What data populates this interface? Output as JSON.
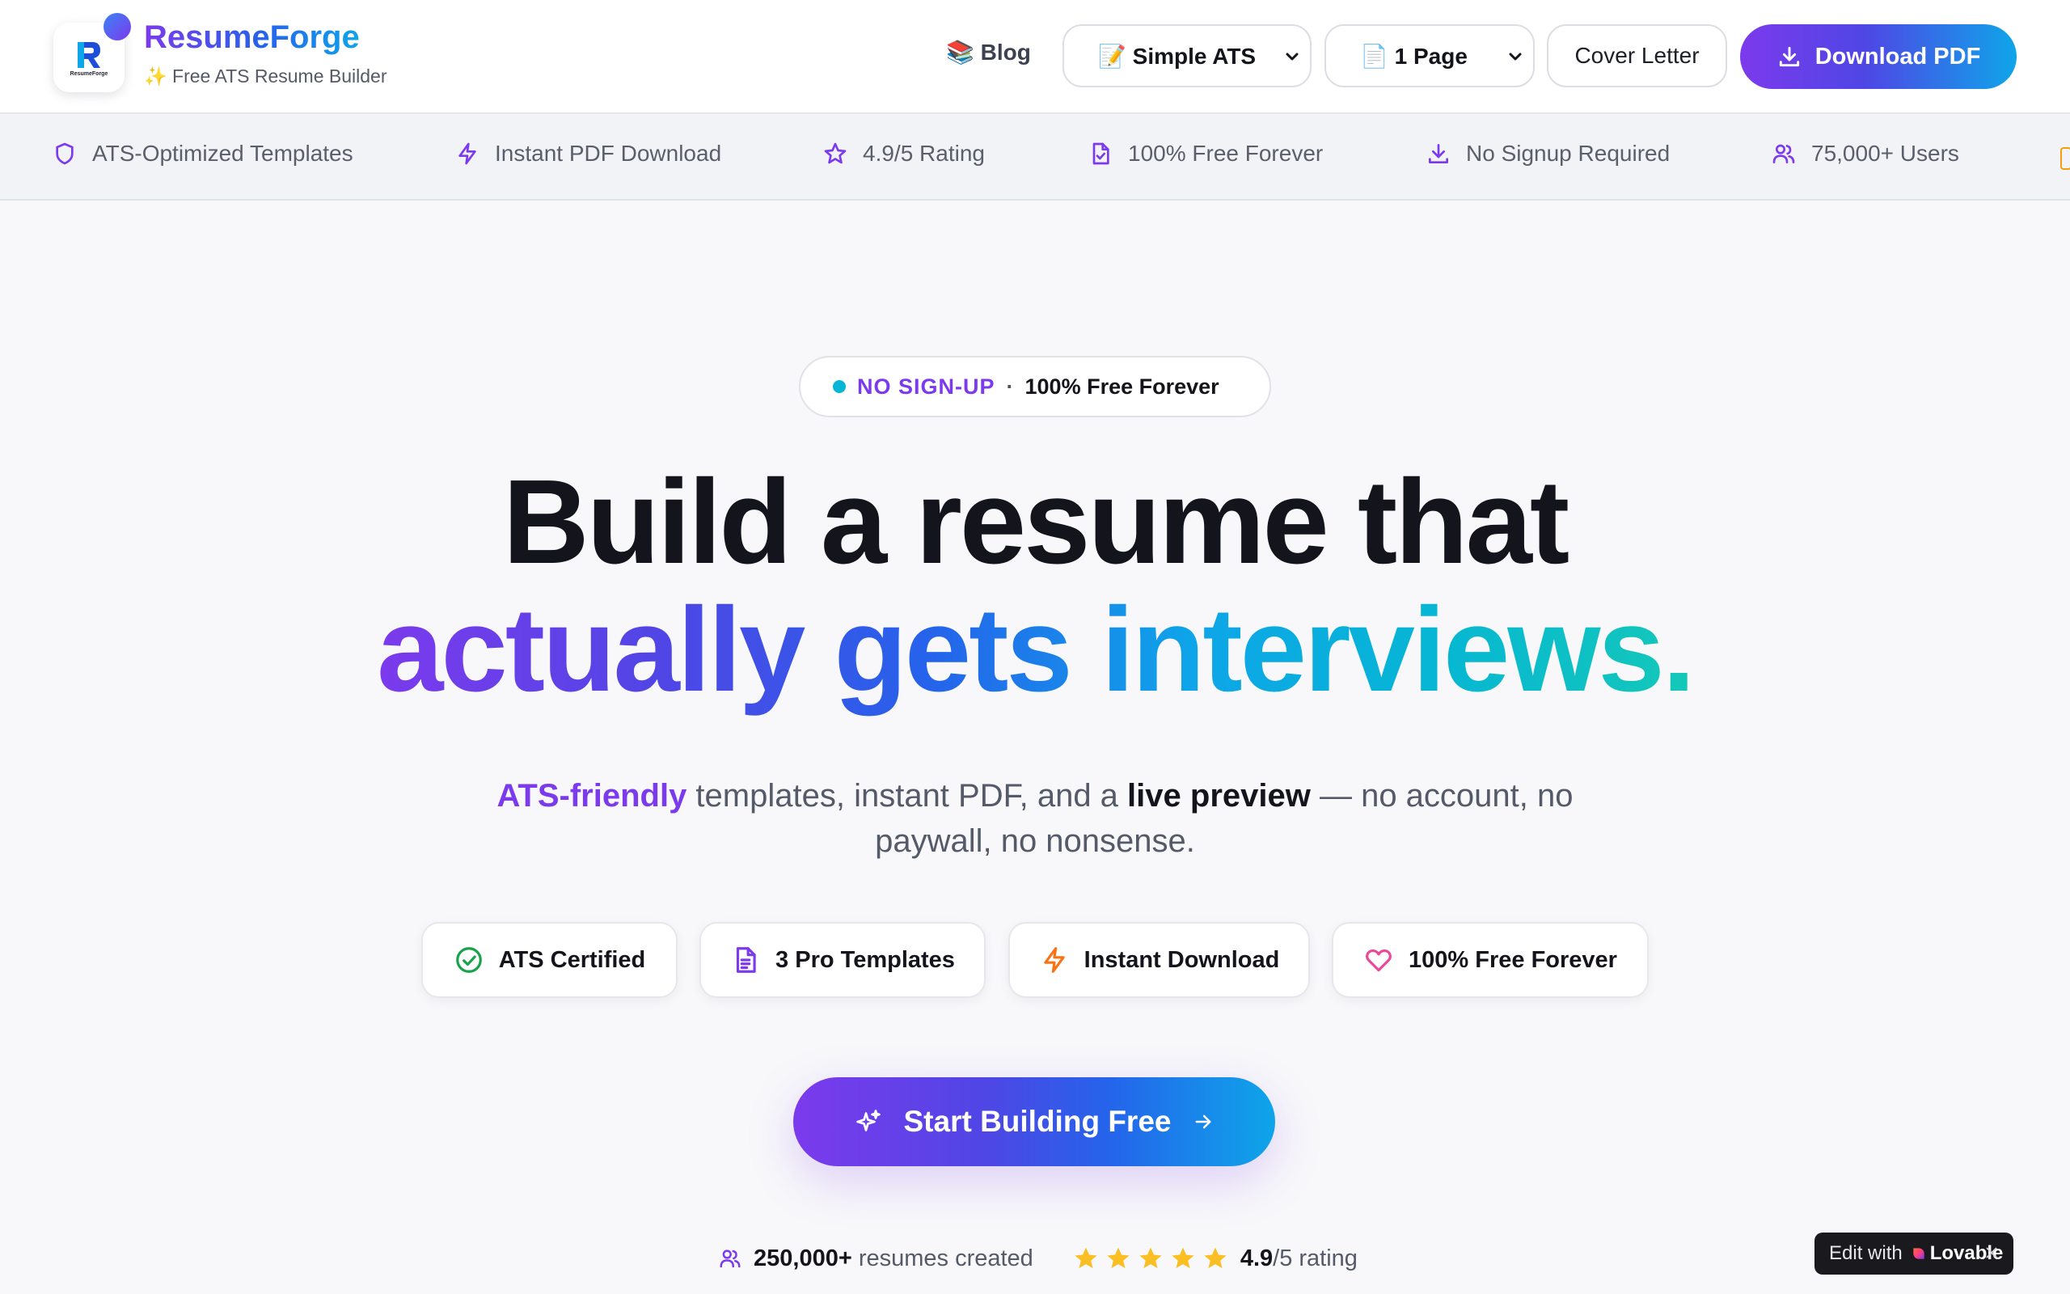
{
  "header": {
    "brand_name": "ResumeForge",
    "brand_tagline": "✨ Free ATS Resume Builder",
    "logo_small_text": "ResumeForge",
    "nav_blog": "📚 Blog",
    "template_select": "📝 Simple ATS",
    "pages_select": "📄 1 Page",
    "cover_letter": "Cover Letter",
    "download": "Download PDF"
  },
  "strip": {
    "items": [
      {
        "label": "ATS-Optimized Templates",
        "icon": "shield-icon"
      },
      {
        "label": "Instant PDF Download",
        "icon": "lightning-icon"
      },
      {
        "label": "4.9/5 Rating",
        "icon": "star-icon"
      },
      {
        "label": "100% Free Forever",
        "icon": "file-check-icon"
      },
      {
        "label": "No Signup Required",
        "icon": "download-icon"
      },
      {
        "label": "75,000+ Users",
        "icon": "users-icon"
      }
    ]
  },
  "hero": {
    "pill_a": "NO SIGN-UP",
    "pill_sep": "·",
    "pill_b": "100% Free Forever",
    "title_line1": "Build a resume that",
    "title_line2": "actually gets interviews.",
    "sub_hl1": "ATS-friendly",
    "sub_t1": " templates, instant PDF, and a ",
    "sub_hl2": "live preview",
    "sub_t2": " — no account, no paywall, no nonsense.",
    "chips": [
      {
        "label": "ATS Certified",
        "icon": "check-circle-icon",
        "color": "#16a34a"
      },
      {
        "label": "3 Pro Templates",
        "icon": "document-icon",
        "color": "#7c3aed"
      },
      {
        "label": "Instant Download",
        "icon": "lightning-icon",
        "color": "#f97316"
      },
      {
        "label": "100% Free Forever",
        "icon": "heart-icon",
        "color": "#ec4899"
      }
    ],
    "cta": "Start Building Free",
    "stat_users_num": "250,000+",
    "stat_users_text": " resumes created",
    "rating_stars": 5,
    "rating_num": "4.9",
    "rating_text": "/5 rating"
  },
  "lovable": {
    "edit_with": "Edit with",
    "brand": "Lovable"
  },
  "colors": {
    "accent_purple": "#7c3aed",
    "accent_blue": "#2563eb",
    "accent_cyan": "#0ea5e9",
    "star": "#fbbf24"
  }
}
